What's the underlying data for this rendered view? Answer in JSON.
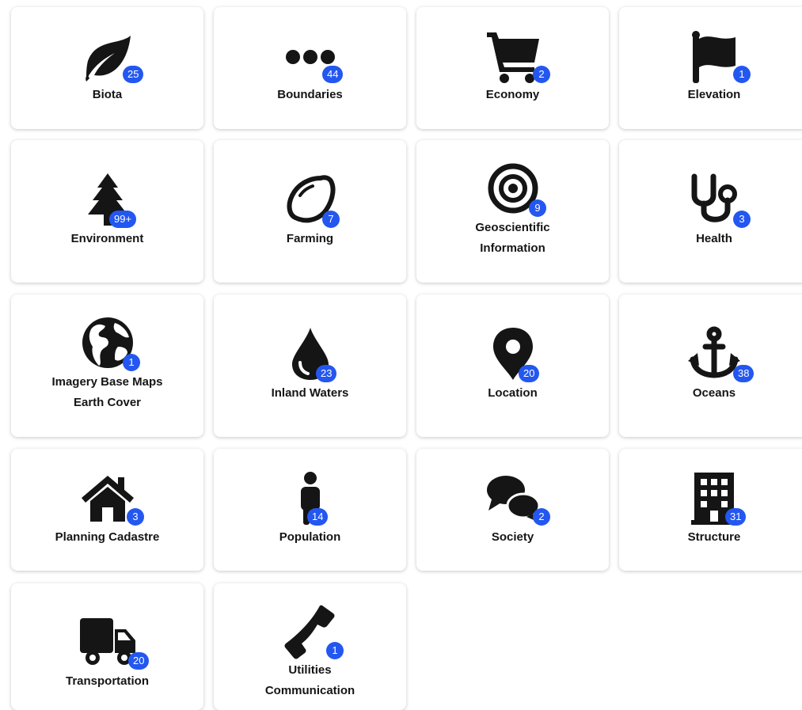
{
  "accent_color": "#2357f0",
  "icon_color": "#151515",
  "categories": [
    {
      "label": "Biota",
      "count": "25",
      "icon": "leaf-icon"
    },
    {
      "label": "Boundaries",
      "count": "44",
      "icon": "ellipsis-icon"
    },
    {
      "label": "Economy",
      "count": "2",
      "icon": "shopping-cart-icon"
    },
    {
      "label": "Elevation",
      "count": "1",
      "icon": "flag-icon"
    },
    {
      "label": "Environment",
      "count": "99+",
      "icon": "tree-icon"
    },
    {
      "label": "Farming",
      "count": "7",
      "icon": "lemon-icon"
    },
    {
      "label": "Geoscientific",
      "label2": "Information",
      "count": "9",
      "icon": "bullseye-icon"
    },
    {
      "label": "Health",
      "count": "3",
      "icon": "stethoscope-icon"
    },
    {
      "label": "Imagery Base Maps",
      "label2": "Earth Cover",
      "count": "1",
      "icon": "globe-icon"
    },
    {
      "label": "Inland Waters",
      "count": "23",
      "icon": "water-drop-icon"
    },
    {
      "label": "Location",
      "count": "20",
      "icon": "map-marker-icon"
    },
    {
      "label": "Oceans",
      "count": "38",
      "icon": "anchor-icon"
    },
    {
      "label": "Planning Cadastre",
      "count": "3",
      "icon": "house-icon"
    },
    {
      "label": "Population",
      "count": "14",
      "icon": "person-icon"
    },
    {
      "label": "Society",
      "count": "2",
      "icon": "comments-icon"
    },
    {
      "label": "Structure",
      "count": "31",
      "icon": "building-icon"
    },
    {
      "label": "Transportation",
      "count": "20",
      "icon": "truck-icon"
    },
    {
      "label": "Utilities",
      "label2": "Communication",
      "count": "1",
      "icon": "phone-icon"
    }
  ]
}
